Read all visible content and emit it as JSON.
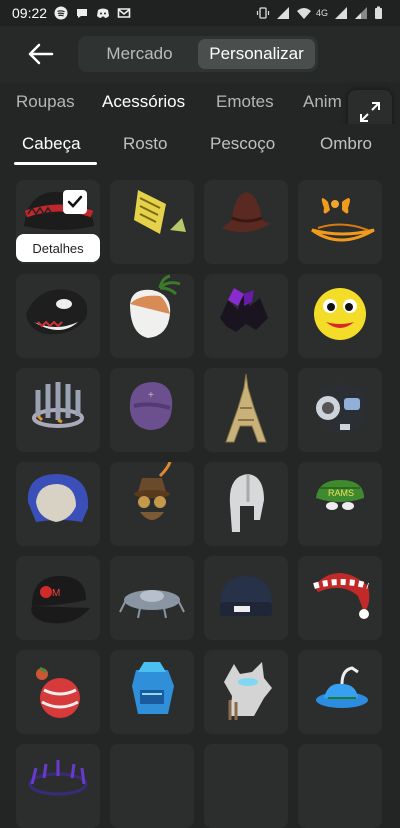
{
  "status": {
    "time": "09:22",
    "net": "4G"
  },
  "tabs": [
    {
      "label": "Mercado"
    },
    {
      "label": "Personalizar"
    }
  ],
  "categories": [
    {
      "label": "Roupas"
    },
    {
      "label": "Acessórios"
    },
    {
      "label": "Emotes"
    },
    {
      "label": "Anim"
    }
  ],
  "subcategories": [
    {
      "label": "Cabeça"
    },
    {
      "label": "Rosto"
    },
    {
      "label": "Pescoço"
    },
    {
      "label": "Ombro"
    }
  ],
  "selected_item": {
    "action_label": "Detalhes"
  },
  "items": [
    {
      "icon": "red-beanie-hat-icon"
    },
    {
      "icon": "yellow-arrow-hat-icon"
    },
    {
      "icon": "cowboy-hat-icon"
    },
    {
      "icon": "orange-bow-hat-icon"
    },
    {
      "icon": "orca-hat-icon"
    },
    {
      "icon": "coconut-hat-icon"
    },
    {
      "icon": "purple-bow-ears-icon"
    },
    {
      "icon": "yellow-smiley-head-icon"
    },
    {
      "icon": "spiked-crown-icon"
    },
    {
      "icon": "purple-hood-icon"
    },
    {
      "icon": "eiffel-tower-icon"
    },
    {
      "icon": "robot-head-icon"
    },
    {
      "icon": "blue-hood-icon"
    },
    {
      "icon": "steampunk-goggles-icon"
    },
    {
      "icon": "knight-helmet-icon"
    },
    {
      "icon": "green-cap-icon"
    },
    {
      "icon": "black-cap-icon"
    },
    {
      "icon": "ufo-halo-icon"
    },
    {
      "icon": "navy-beanie-icon"
    },
    {
      "icon": "santa-hat-icon"
    },
    {
      "icon": "candy-ornament-icon"
    },
    {
      "icon": "blue-crystal-head-icon"
    },
    {
      "icon": "wolf-hood-icon"
    },
    {
      "icon": "blue-bird-hat-icon"
    },
    {
      "icon": "purple-halo-icon"
    },
    {
      "icon": "empty-slot-icon"
    },
    {
      "icon": "empty-slot-icon"
    },
    {
      "icon": "empty-slot-icon"
    }
  ]
}
